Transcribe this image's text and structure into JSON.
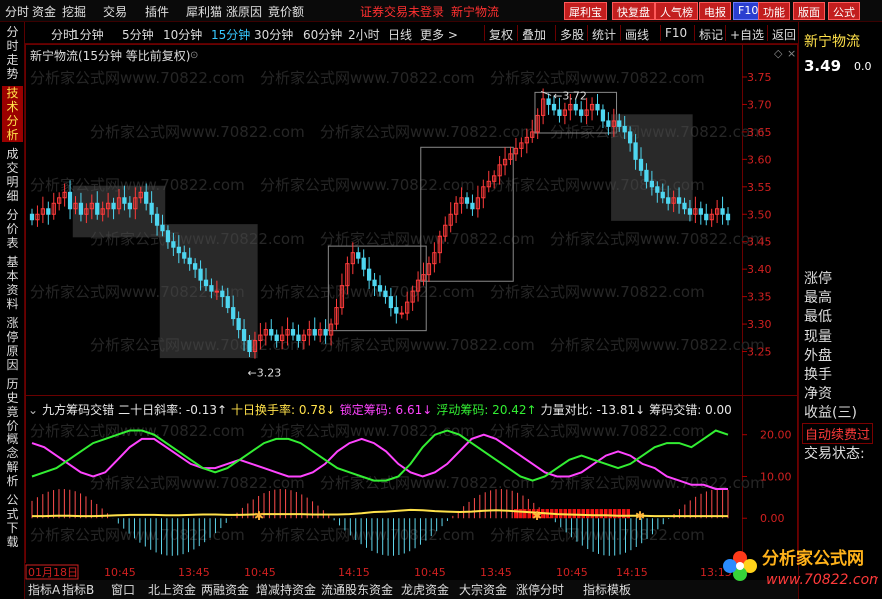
{
  "menu": {
    "items": [
      "分时",
      "资金",
      "挖掘",
      "交易",
      "插件",
      "犀利猫",
      "涨原因",
      "竟价额"
    ],
    "warning": "证券交易未登录",
    "stock": "新宁物流",
    "buttons": [
      "犀利宝",
      "快复盘",
      "人气榜",
      "电报",
      "F10",
      "功能",
      "版面",
      "公式"
    ]
  },
  "left_nav": [
    "分时走势",
    "技术分析",
    "成交明细",
    "分价表",
    "基本资料",
    "涨停原因",
    "历史竟价",
    "概念解析",
    "公式下载"
  ],
  "timeframes": [
    "分时",
    "1分钟",
    "5分钟",
    "10分钟",
    "15分钟",
    "30分钟",
    "60分钟",
    "2小时",
    "日线",
    "更多 >"
  ],
  "toolbar": [
    "复权",
    "叠加",
    "多股",
    "统计",
    "画线",
    "F10",
    "标记",
    "+自选",
    "返回"
  ],
  "chart_title": "新宁物流(15分钟 等比前复权)",
  "indicator": {
    "name": "九方筹码交错",
    "items": [
      {
        "label": "二十日斜率: -0.13↑",
        "color": "#e8e8e8"
      },
      {
        "label": "十日换手率: 0.78↓",
        "color": "#ffe14a"
      },
      {
        "label": "锁定筹码: 6.61↓",
        "color": "#ff44ff"
      },
      {
        "label": "浮动筹码: 20.42↑",
        "color": "#33ee33"
      },
      {
        "label": "力量对比: -13.81↓",
        "color": "#e8e8e8"
      },
      {
        "label": "筹码交错: 0.00",
        "color": "#e8e8e8"
      }
    ]
  },
  "right_panel": {
    "stock": "新宁物流",
    "price": "3.49",
    "change": "0.0",
    "rows": [
      "涨停",
      "最高",
      "最低",
      "现量",
      "外盘",
      "换手",
      "净资",
      "收益(三)"
    ],
    "auto_fee": "自动续费过",
    "trade_status": "交易状态:"
  },
  "watermark": "分析家公式网www.70822.com",
  "logo": {
    "title": "分析家公式网",
    "url": "www.70822.com"
  },
  "time_labels": [
    "01月18日",
    "10:45",
    "13:45",
    "10:45",
    "14:15",
    "10:45",
    "13:45",
    "10:45",
    "14:15",
    "13:15"
  ],
  "bottom_tabs": [
    "指标A",
    "指标B",
    "窗口",
    "北上资金",
    "两融资金",
    "增减持资金",
    "流通股东资金",
    "龙虎资金",
    "大宗资金",
    "涨停分时",
    "指标模板"
  ],
  "chart_data": {
    "type": "candlestick",
    "y_ticks": [
      "3.75",
      "3.70",
      "3.65",
      "3.60",
      "3.55",
      "3.50",
      "3.45",
      "3.40",
      "3.35",
      "3.30",
      "3.25"
    ],
    "ylim": [
      3.22,
      3.77
    ],
    "high_label": "3.72",
    "low_label": "3.23",
    "closes": [
      3.49,
      3.5,
      3.51,
      3.5,
      3.52,
      3.53,
      3.54,
      3.51,
      3.52,
      3.5,
      3.51,
      3.52,
      3.5,
      3.51,
      3.52,
      3.51,
      3.53,
      3.52,
      3.51,
      3.53,
      3.54,
      3.52,
      3.5,
      3.48,
      3.47,
      3.45,
      3.44,
      3.43,
      3.42,
      3.41,
      3.4,
      3.38,
      3.37,
      3.36,
      3.36,
      3.35,
      3.33,
      3.31,
      3.29,
      3.27,
      3.25,
      3.27,
      3.28,
      3.29,
      3.28,
      3.27,
      3.28,
      3.29,
      3.28,
      3.27,
      3.28,
      3.29,
      3.28,
      3.29,
      3.28,
      3.3,
      3.33,
      3.37,
      3.41,
      3.43,
      3.42,
      3.4,
      3.38,
      3.37,
      3.36,
      3.35,
      3.33,
      3.32,
      3.32,
      3.34,
      3.36,
      3.38,
      3.39,
      3.41,
      3.43,
      3.46,
      3.48,
      3.5,
      3.52,
      3.53,
      3.52,
      3.51,
      3.53,
      3.55,
      3.56,
      3.57,
      3.59,
      3.6,
      3.61,
      3.62,
      3.63,
      3.64,
      3.65,
      3.68,
      3.71,
      3.7,
      3.69,
      3.68,
      3.69,
      3.7,
      3.69,
      3.68,
      3.69,
      3.7,
      3.69,
      3.67,
      3.66,
      3.67,
      3.66,
      3.65,
      3.63,
      3.6,
      3.58,
      3.56,
      3.55,
      3.54,
      3.53,
      3.52,
      3.53,
      3.52,
      3.51,
      3.5,
      3.51,
      3.5,
      3.49,
      3.5,
      3.51,
      3.5,
      3.49
    ]
  },
  "indicator_chart": {
    "ylim": [
      -10,
      24
    ],
    "y_ticks": [
      "20.00",
      "10.00",
      "0.00"
    ],
    "green": [
      10,
      11,
      12,
      14,
      16,
      18,
      19,
      20,
      21,
      21,
      20,
      18,
      16,
      14,
      12,
      11,
      12,
      14,
      16,
      18,
      19,
      19,
      18,
      16,
      14,
      12,
      11,
      10,
      9,
      9,
      10,
      13,
      17,
      20,
      21,
      20,
      18,
      16,
      14,
      12,
      10,
      9,
      10,
      12,
      14,
      15,
      14,
      13,
      12,
      13,
      15,
      17,
      18,
      18,
      17,
      19,
      21,
      20
    ],
    "magenta": [
      18,
      17,
      15,
      13,
      11,
      10,
      11,
      14,
      17,
      19,
      19,
      17,
      15,
      13,
      12,
      12,
      13,
      14,
      13,
      12,
      11,
      10,
      10,
      11,
      13,
      16,
      18,
      19,
      18,
      16,
      13,
      11,
      10,
      11,
      13,
      16,
      19,
      20,
      19,
      17,
      15,
      13,
      11,
      10,
      10,
      11,
      13,
      15,
      16,
      15,
      13,
      12,
      10,
      9,
      8,
      8,
      7,
      7
    ],
    "yellow": [
      0.5,
      0.5,
      0.6,
      0.6,
      0.5,
      0.5,
      0.6,
      0.7,
      0.8,
      0.8,
      0.8,
      0.7,
      0.7,
      0.8,
      0.9,
      0.9,
      0.8,
      0.8,
      0.9,
      1.0,
      1.0,
      1.0,
      1.0,
      0.9,
      0.9,
      0.9,
      1.0,
      1.2,
      1.5,
      1.6,
      1.8,
      2.0,
      1.9,
      1.7,
      1.6,
      1.5,
      1.6,
      1.8,
      1.9,
      1.8,
      1.6,
      1.4,
      1.2,
      1.0,
      0.9,
      0.8,
      0.7,
      0.7,
      0.6,
      0.6,
      0.6,
      0.5,
      0.5,
      0.5,
      0.5,
      0.5,
      0.5,
      0.5
    ]
  }
}
